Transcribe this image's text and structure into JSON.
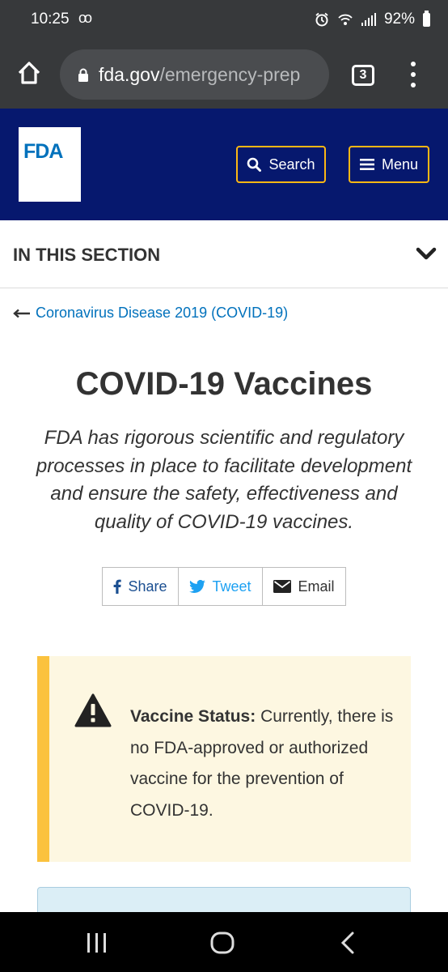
{
  "status_bar": {
    "time": "10:25",
    "voicemail": "oo",
    "battery": "92%"
  },
  "browser": {
    "url_host": "fda.gov",
    "url_path": "/emergency-prep",
    "tab_count": "3"
  },
  "header": {
    "logo_text": "FDA",
    "search_label": "Search",
    "menu_label": "Menu",
    "bg_color": "#06186e",
    "accent_color": "#fdb714"
  },
  "section_nav": {
    "label": "IN THIS SECTION"
  },
  "breadcrumb": {
    "label": "Coronavirus Disease 2019 (COVID-19)"
  },
  "main": {
    "title": "COVID-19 Vaccines",
    "lead": "FDA has rigorous scientific and regulatory processes in place to facilitate development and ensure the safety, effectiveness and quality of COVID-19 vaccines."
  },
  "share": {
    "share_label": "Share",
    "tweet_label": "Tweet",
    "email_label": "Email"
  },
  "alert": {
    "heading": "Vaccine Status:",
    "body": "Currently, there is no FDA-approved or authorized vaccine for the prevention of COVID-19.",
    "accent_color": "#fbc23e"
  }
}
